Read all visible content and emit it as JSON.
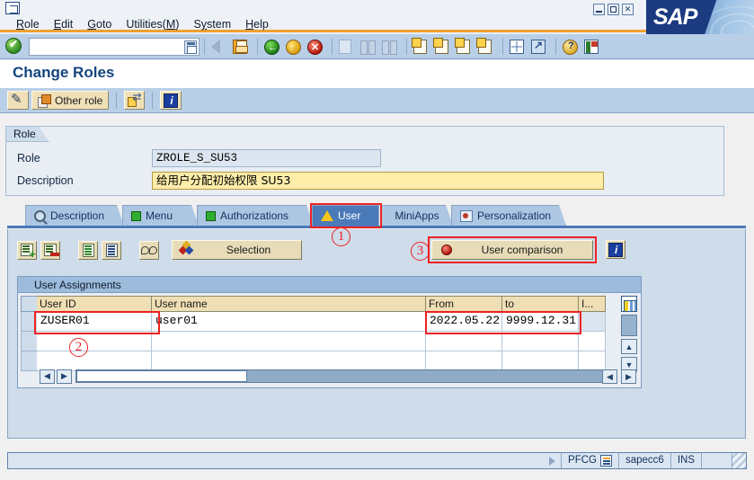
{
  "window": {
    "menu": [
      {
        "label": "Role",
        "accel": "R"
      },
      {
        "label": "Edit",
        "accel": "E"
      },
      {
        "label": "Goto",
        "accel": "G"
      },
      {
        "label": "Utilities(M)",
        "accel": "M"
      },
      {
        "label": "System",
        "accel": "y"
      },
      {
        "label": "Help",
        "accel": "H"
      }
    ],
    "minimize_label": "_",
    "maximize_label": "□",
    "close_label": "×",
    "brand": "SAP"
  },
  "toolbar": {
    "command_value": "",
    "command_placeholder": "",
    "icons": [
      "enter-check-icon",
      "back-arrow-icon",
      "save-icon",
      "exit-green-icon",
      "back-yellow-icon",
      "cancel-red-icon",
      "print-icon",
      "find-icon",
      "find-next-icon",
      "first-page-icon",
      "previous-page-icon",
      "next-page-icon",
      "last-page-icon",
      "grid-icon",
      "grid-arrow-icon",
      "help-icon",
      "layout-menu-icon"
    ]
  },
  "page": {
    "title": "Change Roles"
  },
  "app_toolbar": {
    "display_change_label": "",
    "other_role_label": "Other role",
    "expand_label": "",
    "info_label": ""
  },
  "role_group": {
    "legend": "Role",
    "fields": [
      {
        "label": "Role",
        "value": "ZROLE_S_SU53",
        "state": "readonly"
      },
      {
        "label": "Description",
        "value": "给用户分配初始权限 SU53",
        "state": "editable"
      }
    ]
  },
  "tabs": [
    {
      "label": "Description",
      "icon": "magnifier-icon",
      "active": false
    },
    {
      "label": "Menu",
      "icon": "green-square-icon",
      "active": false
    },
    {
      "label": "Authorizations",
      "icon": "green-square-icon",
      "active": false
    },
    {
      "label": "User",
      "icon": "warning-triangle-icon",
      "active": true
    },
    {
      "label": "MiniApps",
      "icon": "",
      "active": false
    },
    {
      "label": "Personalization",
      "icon": "personalization-icon",
      "active": false
    }
  ],
  "sub_toolbar": {
    "buttons": [
      {
        "name": "insert-row-button",
        "icon": "row-add-icon"
      },
      {
        "name": "delete-row-button",
        "icon": "row-delete-icon"
      },
      {
        "name": "select-all-button",
        "icon": "doc-green-icon"
      },
      {
        "name": "deselect-all-button",
        "icon": "doc-blue-icon"
      },
      {
        "name": "display-button",
        "icon": "glasses-icon"
      }
    ],
    "selection_label": "Selection",
    "user_comparison_label": "User comparison",
    "info_label": ""
  },
  "table": {
    "title": "User Assignments",
    "columns": [
      "User ID",
      "User name",
      "From",
      "to",
      "I..."
    ],
    "rows": [
      {
        "user_id": "ZUSER01",
        "user_name": "user01",
        "from": "2022.05.22",
        "to": "9999.12.31",
        "i": ""
      },
      {
        "user_id": "",
        "user_name": "",
        "from": "",
        "to": "",
        "i": ""
      },
      {
        "user_id": "",
        "user_name": "",
        "from": "",
        "to": "",
        "i": ""
      }
    ],
    "scroll": {
      "left_arrow": "◀",
      "right_arrow": "▶",
      "up_arrow": "▲",
      "down_arrow": "▼"
    }
  },
  "annotations": [
    {
      "id": "annotation-1",
      "label": "①",
      "text": "1"
    },
    {
      "id": "annotation-2",
      "label": "②",
      "text": "2"
    },
    {
      "id": "annotation-3",
      "label": "③",
      "text": "3"
    }
  ],
  "status_bar": {
    "message": "",
    "transaction": "PFCG",
    "system": "sapecc6",
    "mode": "INS"
  },
  "colors": {
    "accent_orange": "#f0a030",
    "sap_blue": "#1b3a80",
    "highlight_red": "#ee2222",
    "tab_active": "#4a7ab8",
    "editable_yellow": "#ffedaa"
  }
}
